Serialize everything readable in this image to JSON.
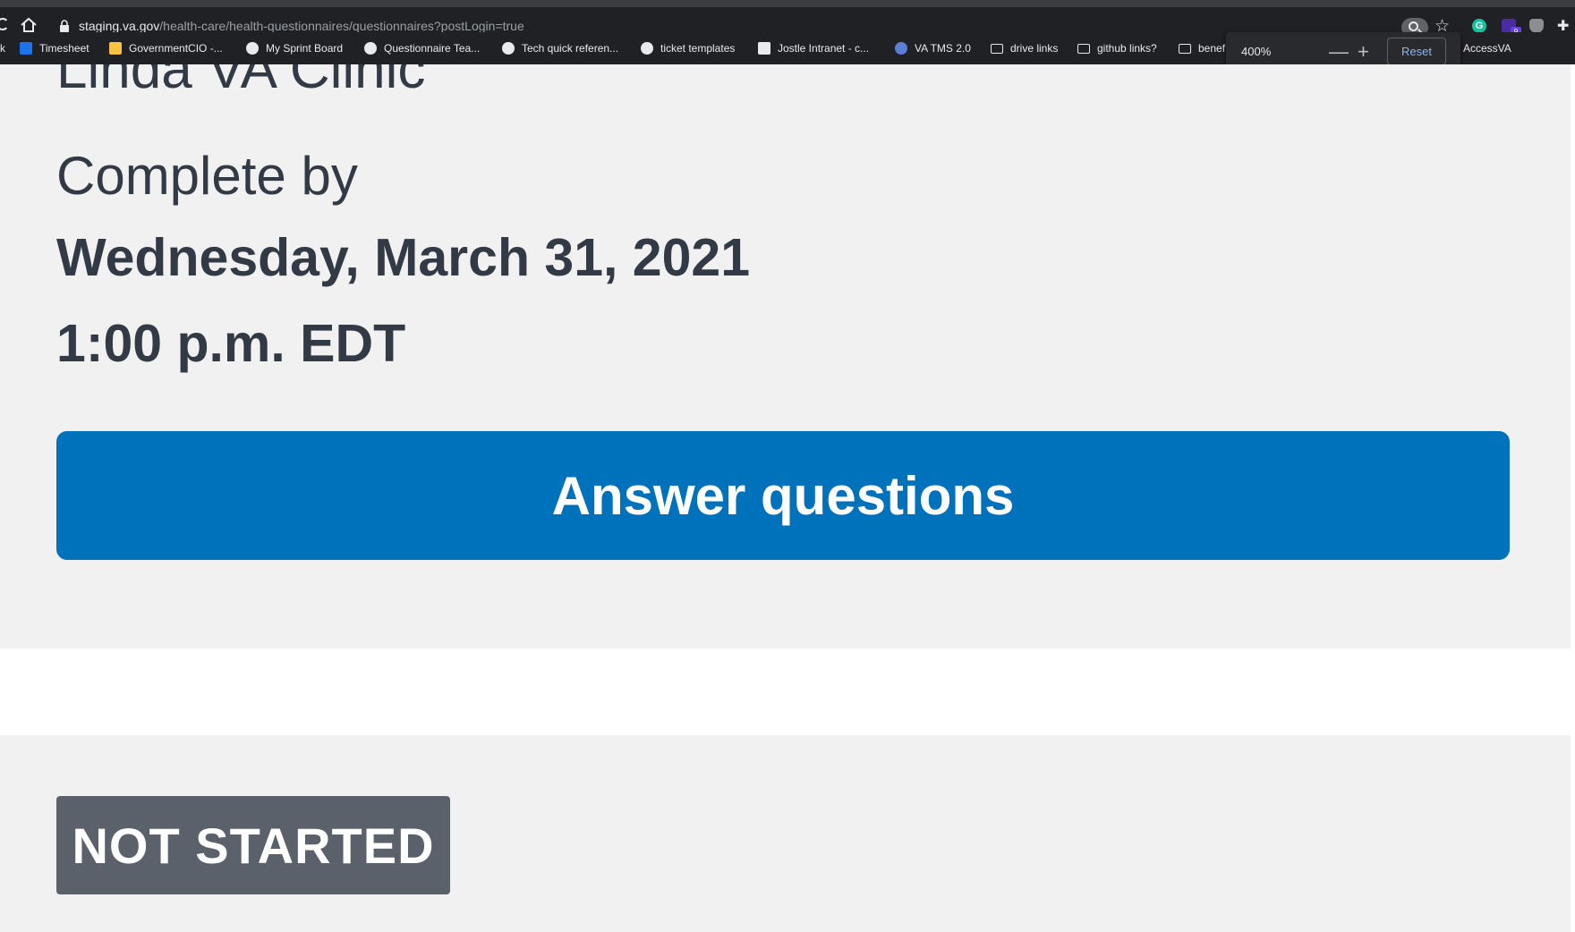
{
  "browser": {
    "url_domain": "staging.va.gov",
    "url_path": "/health-care/health-questionnaires/questionnaires?postLogin=true",
    "extension_badge": "9",
    "grammarly_letter": "G",
    "bookmarks": [
      {
        "label": "k",
        "icon": "bookmark-icon"
      },
      {
        "label": "Timesheet",
        "icon": "timesheet-icon"
      },
      {
        "label": "GovernmentCIO -...",
        "icon": "calendar-icon"
      },
      {
        "label": "My Sprint Board",
        "icon": "github-icon"
      },
      {
        "label": "Questionnaire Tea...",
        "icon": "github-icon"
      },
      {
        "label": "Tech quick referen...",
        "icon": "github-icon"
      },
      {
        "label": "ticket templates",
        "icon": "github-icon"
      },
      {
        "label": "Jostle Intranet - c...",
        "icon": "jostle-icon"
      },
      {
        "label": "VA TMS 2.0",
        "icon": "tms-icon"
      },
      {
        "label": "drive links",
        "icon": "folder-icon"
      },
      {
        "label": "github links?",
        "icon": "folder-icon"
      },
      {
        "label": "benef",
        "icon": "folder-icon"
      },
      {
        "label": "AccessVA",
        "icon": "folder-icon"
      }
    ],
    "zoom": {
      "level": "400%",
      "minus": "—",
      "plus": "+",
      "reset": "Reset"
    }
  },
  "page": {
    "clinic_name": "Linda VA Clinic",
    "complete_by_label": "Complete by",
    "due_date": "Wednesday, March 31, 2021",
    "due_time": "1:00 p.m. EDT",
    "answer_button": "Answer questions",
    "status_badge": "NOT STARTED"
  }
}
